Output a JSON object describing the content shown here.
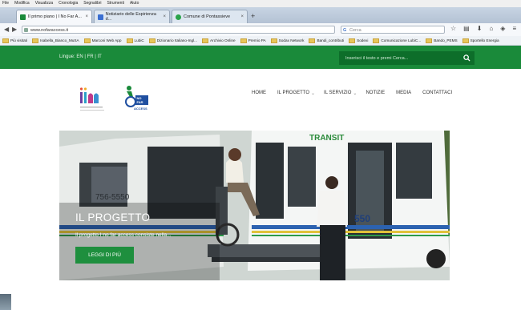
{
  "browser": {
    "menu": [
      "File",
      "Modifica",
      "Visualizza",
      "Cronologia",
      "Segnalibri",
      "Strumenti",
      "Aiuto"
    ],
    "tabs": [
      {
        "label": "Il primo piano | I No Far A...",
        "active": true
      },
      {
        "label": "Notiziario delle Espirienza d...",
        "active": false
      },
      {
        "label": "Comune di Pontassieve",
        "active": false
      }
    ],
    "url": "www.nofaraccess.it",
    "search_placeholder": "Cerca",
    "bookmarks": [
      "Più visitati",
      "Isabella_Bianco_MuSA",
      "Marconi Web App",
      "LubiC",
      "Dizionario Italiano-Ingl...",
      "Archivio Online",
      "Premio PA",
      "Sodax Network",
      "Bandi_contributi",
      "Sodexi",
      "Comunicazione LubiC...",
      "Bando_PEMS",
      "Sportello Energia"
    ]
  },
  "site": {
    "language_label": "Lingue: EN | FR | IT",
    "search_placeholder": "Inserisci il testo e premi Cerca...",
    "logo_text": "NO FAR ACCESS",
    "menu": [
      "HOME",
      "IL PROGETTO",
      "IL SERVIZIO",
      "NOTIZIE",
      "MEDIA",
      "CONTATTACI"
    ],
    "hero": {
      "title": "IL PROGETTO",
      "text": "Il progetto I no far access consiste nella...",
      "button": "LEGGI DI PIÙ",
      "bus_sign": "TRANSIT",
      "bus_number": "550",
      "bus_phone": "756-5550"
    }
  },
  "colors": {
    "brand_green": "#1a8a3a",
    "button_green": "#1e8f3e"
  }
}
